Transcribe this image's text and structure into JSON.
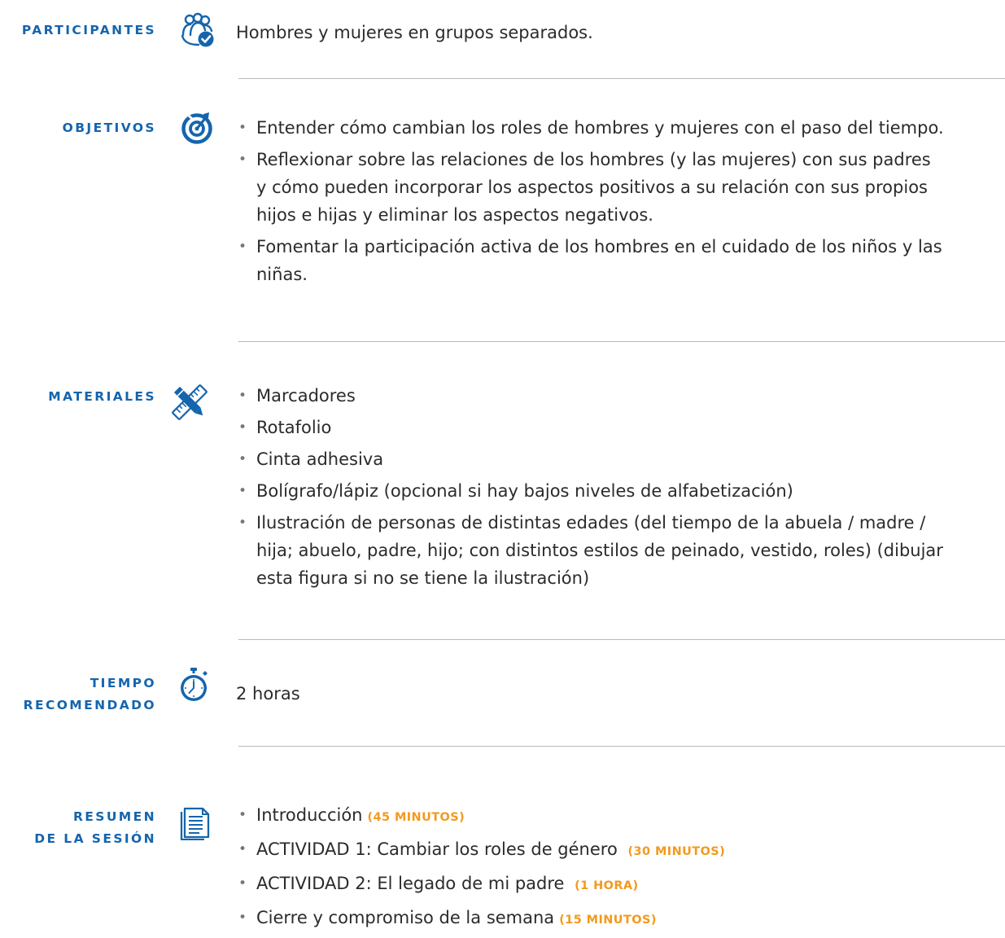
{
  "participantes": {
    "label": "PARTICIPANTES",
    "icon": "group-check-icon",
    "text": "Hombres y mujeres en grupos separados."
  },
  "objetivos": {
    "label": "OBJETIVOS",
    "icon": "target-icon",
    "items": [
      [
        "Entender cómo cambian los roles de hombres y mujeres con el paso del tiempo."
      ],
      [
        "Reflexionar sobre las relaciones de los hombres (y las mujeres) con sus padres",
        "y cómo pueden incorporar los aspectos positivos a su relación con sus propios",
        "hijos e hijas y eliminar los aspectos negativos."
      ],
      [
        "Fomentar la participación activa de los hombres en el cuidado de los niños y las",
        "niñas."
      ]
    ]
  },
  "materiales": {
    "label": "MATERIALES",
    "icon": "ruler-pencil-icon",
    "items": [
      [
        "Marcadores"
      ],
      [
        "Rotafolio"
      ],
      [
        "Cinta adhesiva"
      ],
      [
        "Bolígrafo/lápiz (opcional si hay bajos niveles de alfabetización)"
      ],
      [
        "Ilustración de personas de distintas edades (del tiempo de la abuela / madre /",
        "hija; abuelo, padre, hijo; con distintos estilos de peinado, vestido, roles) (dibujar",
        "esta figura si no se tiene la ilustración)"
      ]
    ]
  },
  "tiempo": {
    "label_line1": "TIEMPO",
    "label_line2": "RECOMENDADO",
    "icon": "stopwatch-icon",
    "text": "2 horas"
  },
  "resumen": {
    "label_line1": "RESUMEN",
    "label_line2": "DE LA SESIÓN",
    "icon": "document-icon",
    "items": [
      {
        "text": "Introducción",
        "duration": "(45 MINUTOS)"
      },
      {
        "text": "ACTIVIDAD 1: Cambiar los roles de género ",
        "duration": "(30 MINUTOS)"
      },
      {
        "text": "ACTIVIDAD 2: El legado de mi padre ",
        "duration": "(1 HORA)"
      },
      {
        "text": "Cierre y compromiso de la semana",
        "duration": "(15 MINUTOS)"
      }
    ]
  },
  "colors": {
    "label_blue": "#1565ad",
    "duration_orange": "#f29a1d",
    "rule_gray": "#b9b9b9",
    "body_text": "#2b2b2b"
  }
}
